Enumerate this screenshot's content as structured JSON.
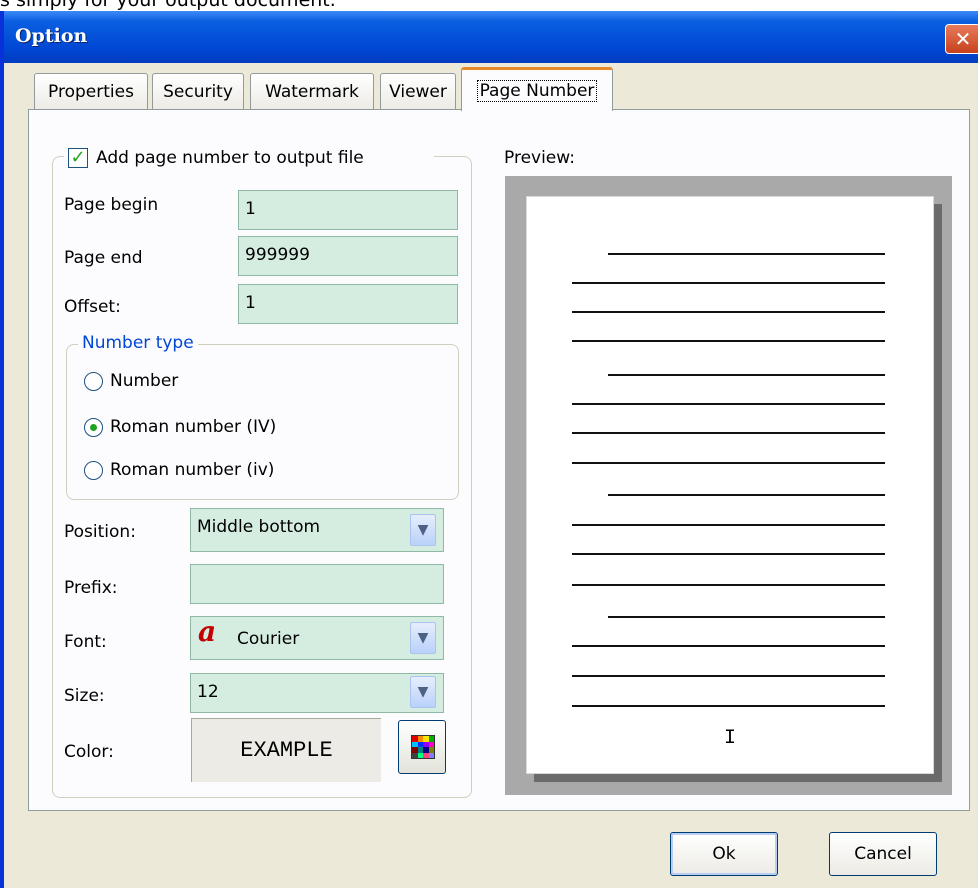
{
  "caption": "s simply for your output document.",
  "window": {
    "title": "Option",
    "close_glyph": "✕"
  },
  "tabs": [
    "Properties",
    "Security",
    "Watermark",
    "Viewer",
    "Page Number"
  ],
  "active_tab": "Page Number",
  "page_number": {
    "add_label": "Add page number to output file",
    "add_checked": true,
    "page_begin_label": "Page begin",
    "page_begin_value": "1",
    "page_end_label": "Page end",
    "page_end_value": "999999",
    "offset_label": "Offset:",
    "offset_value": "1",
    "number_type_title": "Number type",
    "number_type_options": [
      "Number",
      "Roman number (IV)",
      "Roman number (iv)"
    ],
    "number_type_selected": "Roman number (IV)",
    "position_label": "Position:",
    "position_value": "Middle bottom",
    "prefix_label": "Prefix:",
    "prefix_value": "",
    "font_label": "Font:",
    "font_glyph": "a",
    "font_value": "Courier",
    "size_label": "Size:",
    "size_value": "12",
    "color_label": "Color:",
    "color_example": "EXAMPLE"
  },
  "preview": {
    "label": "Preview:",
    "page_number_text": "I"
  },
  "buttons": {
    "ok": "Ok",
    "cancel": "Cancel"
  },
  "icons": {
    "checkbox": "check-icon",
    "dropdown": "chevron-down-icon",
    "color_picker": "color-palette-icon"
  },
  "colors": {
    "title_bar": "#0048d5",
    "field_bg": "#d4ede0",
    "active_tab_accent": "#e68b2c",
    "group_title": "#0046d5"
  }
}
